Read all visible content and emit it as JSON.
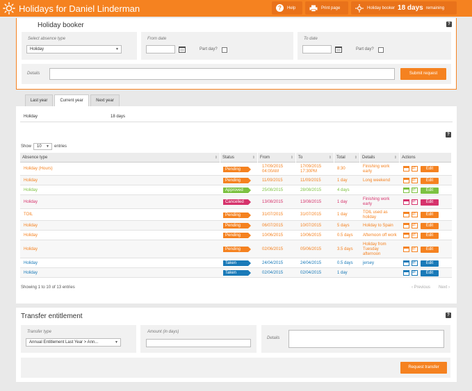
{
  "header": {
    "title": "Holidays for Daniel Linderman",
    "help_label": "Help",
    "print_label": "Print page",
    "booker_label": "Holiday booker",
    "days_remaining_number": "18 days",
    "days_remaining_text": "remaining"
  },
  "booker": {
    "title": "Holiday booker",
    "absence_label": "Select absence type",
    "absence_value": "Holiday",
    "from_label": "From date",
    "to_label": "To date",
    "part_day_label": "Part day?",
    "details_label": "Details",
    "submit_label": "Submit request"
  },
  "tabs": [
    {
      "label": "Last year"
    },
    {
      "label": "Current year"
    },
    {
      "label": "Next year"
    }
  ],
  "summary": {
    "type": "Holiday",
    "days": "18 days"
  },
  "table": {
    "show_label": "Show",
    "page_size": "10",
    "entries_label": "entries",
    "headers": [
      "Absence type",
      "Status",
      "From",
      "To",
      "Total",
      "Details",
      "Actions"
    ],
    "rows": [
      {
        "type": "Holiday (Hours)",
        "status": "Pending",
        "from": [
          "17/09/2015",
          "04:00AM"
        ],
        "to": [
          "17/09/2015",
          "17:30PM"
        ],
        "total": "8:30",
        "details": [
          "Finishing work",
          "early"
        ],
        "action": "Edit"
      },
      {
        "type": "Holiday",
        "status": "Pending",
        "from": [
          "11/09/2015"
        ],
        "to": [
          "11/09/2015"
        ],
        "total": "1 day",
        "details": [
          "Long weekend"
        ],
        "action": "Edit"
      },
      {
        "type": "Holiday",
        "status": "Approved",
        "from": [
          "25/08/2015"
        ],
        "to": [
          "28/08/2015"
        ],
        "total": "4 days",
        "details": [
          ""
        ],
        "action": "Edit"
      },
      {
        "type": "Holiday",
        "status": "Cancelled",
        "from": [
          "13/08/2015"
        ],
        "to": [
          "13/08/2015"
        ],
        "total": "1 day",
        "details": [
          "Finishing work",
          "early"
        ],
        "action": "Edit"
      },
      {
        "type": "TOIL",
        "status": "Pending",
        "from": [
          "31/07/2015"
        ],
        "to": [
          "31/07/2015"
        ],
        "total": "1 day",
        "details": [
          "TOIL used as",
          "holiday"
        ],
        "action": "Edit"
      },
      {
        "type": "Holiday",
        "status": "Pending",
        "from": [
          "06/07/2015"
        ],
        "to": [
          "10/07/2015"
        ],
        "total": "5 days",
        "details": [
          "Holiday to Spain"
        ],
        "action": "Edit"
      },
      {
        "type": "Holiday",
        "status": "Pending",
        "from": [
          "10/06/2015"
        ],
        "to": [
          "10/06/2015"
        ],
        "total": "0.5 days",
        "details": [
          "Afternoon off work"
        ],
        "action": "Edit"
      },
      {
        "type": "Holiday",
        "status": "Pending",
        "from": [
          "02/06/2015"
        ],
        "to": [
          "05/06/2015"
        ],
        "total": "3.5 days",
        "details": [
          "Holiday from",
          "Tuesday",
          "afternoon"
        ],
        "action": "Edit"
      },
      {
        "type": "Holiday",
        "status": "Taken",
        "from": [
          "24/04/2015"
        ],
        "to": [
          "24/04/2015"
        ],
        "total": "0.5 days",
        "details": [
          "jersey"
        ],
        "action": "Edit"
      },
      {
        "type": "Holiday",
        "status": "Taken",
        "from": [
          "02/04/2015"
        ],
        "to": [
          "02/04/2015"
        ],
        "total": "1 day",
        "details": [
          ""
        ],
        "action": "Edit"
      }
    ],
    "footer_info": "Showing 1 to 10 of 13 entries",
    "prev_label": "‹ Previous",
    "next_label": "Next ›"
  },
  "transfer": {
    "title": "Transfer entitlement",
    "type_label": "Transfer type",
    "type_value": "Annual Entitlement Last Year > Ann...",
    "amount_label": "Amount (in days)",
    "details_label": "Details",
    "submit_label": "Request transfer"
  },
  "colors": {
    "brand": "#f58220",
    "pending": "#f58220",
    "approved": "#7dc242",
    "cancelled": "#d6336c",
    "taken": "#1a7ab8"
  }
}
